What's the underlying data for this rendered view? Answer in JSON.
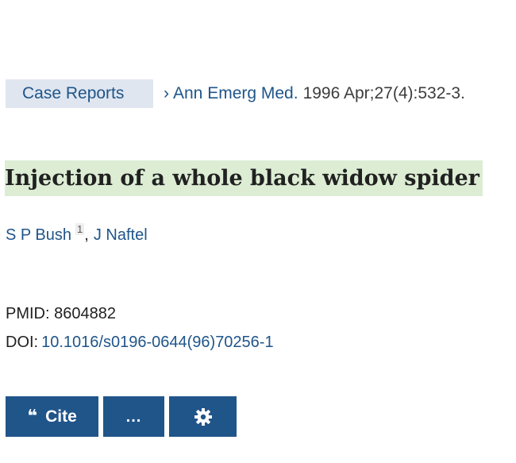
{
  "publication_type": "Case Reports",
  "citation": {
    "chevron": "›",
    "journal": "Ann Emerg Med.",
    "details": "1996 Apr;27(4):532-3."
  },
  "article": {
    "title": "Injection of a whole black widow spider"
  },
  "authors": [
    {
      "name": "S P Bush",
      "affiliation_ref": "1"
    },
    {
      "name": "J Naftel"
    }
  ],
  "author_separator": ",",
  "identifiers": {
    "pmid_label": "PMID:",
    "pmid": "8604882",
    "doi_label": "DOI:",
    "doi": "10.1016/s0196-0644(96)70256-1"
  },
  "actions": {
    "cite_icon": "quote-icon",
    "cite_glyph": "❝",
    "cite_label": "Cite",
    "more_icon": "more-icon",
    "more_label": "...",
    "settings_icon": "gear-icon"
  },
  "colors": {
    "link": "#20558a",
    "button_bg": "#20558a",
    "pub_type_bg": "#dfe6f0",
    "title_highlight": "#dcedd4"
  }
}
